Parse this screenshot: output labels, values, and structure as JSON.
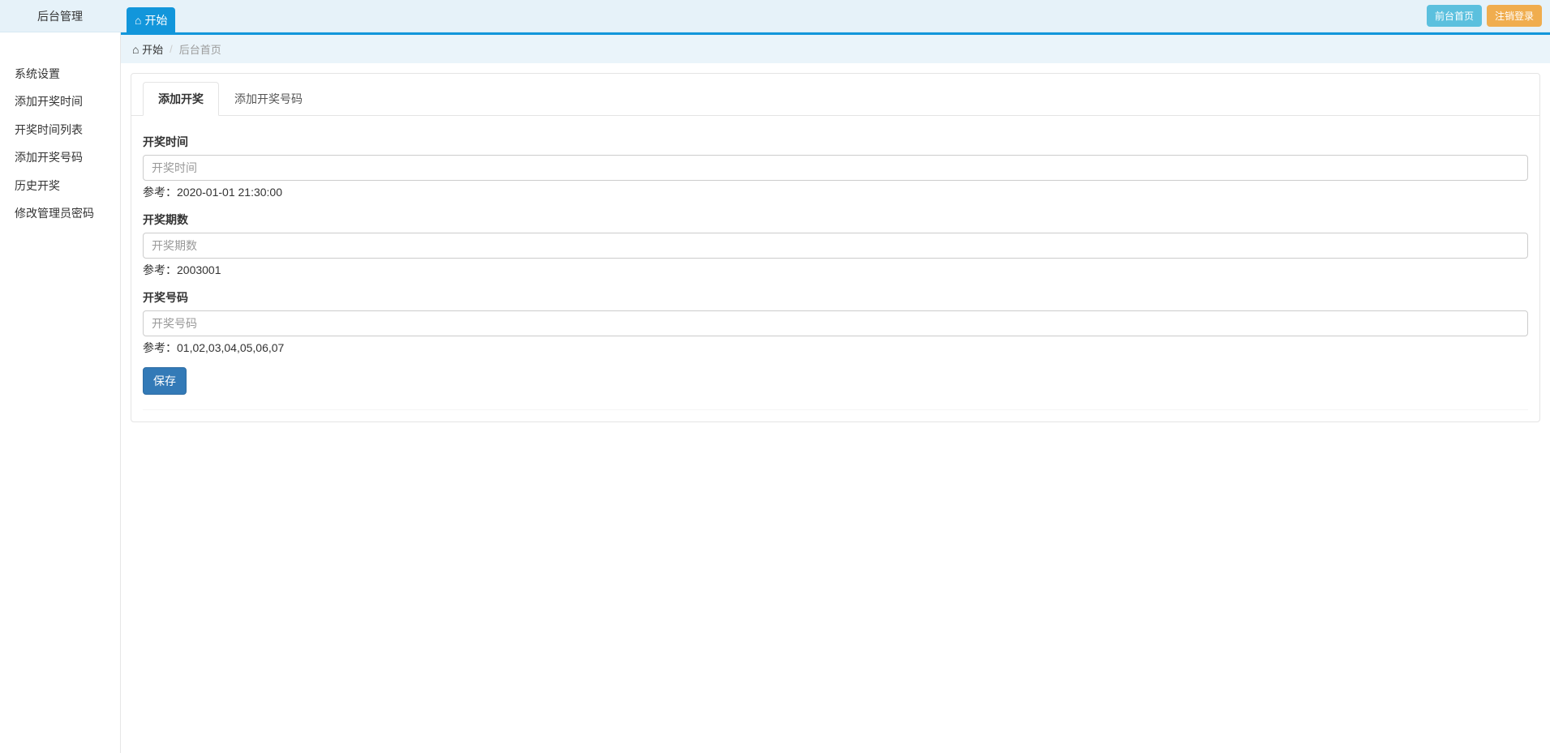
{
  "brand": "后台管理",
  "top_tab": {
    "label": "开始"
  },
  "top_actions": {
    "front_home": "前台首页",
    "logout": "注销登录"
  },
  "sidebar": {
    "items": [
      {
        "label": "系统设置"
      },
      {
        "label": "添加开奖时间"
      },
      {
        "label": "开奖时间列表"
      },
      {
        "label": "添加开奖号码"
      },
      {
        "label": "历史开奖"
      },
      {
        "label": "修改管理员密码"
      }
    ]
  },
  "breadcrumb": {
    "start": "开始",
    "current": "后台首页"
  },
  "tabs": {
    "add_lottery": "添加开奖",
    "add_lottery_number": "添加开奖号码"
  },
  "form": {
    "time_label": "开奖时间",
    "time_placeholder": "开奖时间",
    "time_help": "参考：2020-01-01 21:30:00",
    "time_value": "",
    "period_label": "开奖期数",
    "period_placeholder": "开奖期数",
    "period_help": "参考：2003001",
    "period_value": "",
    "number_label": "开奖号码",
    "number_placeholder": "开奖号码",
    "number_help": "参考：01,02,03,04,05,06,07",
    "number_value": "",
    "submit": "保存"
  }
}
